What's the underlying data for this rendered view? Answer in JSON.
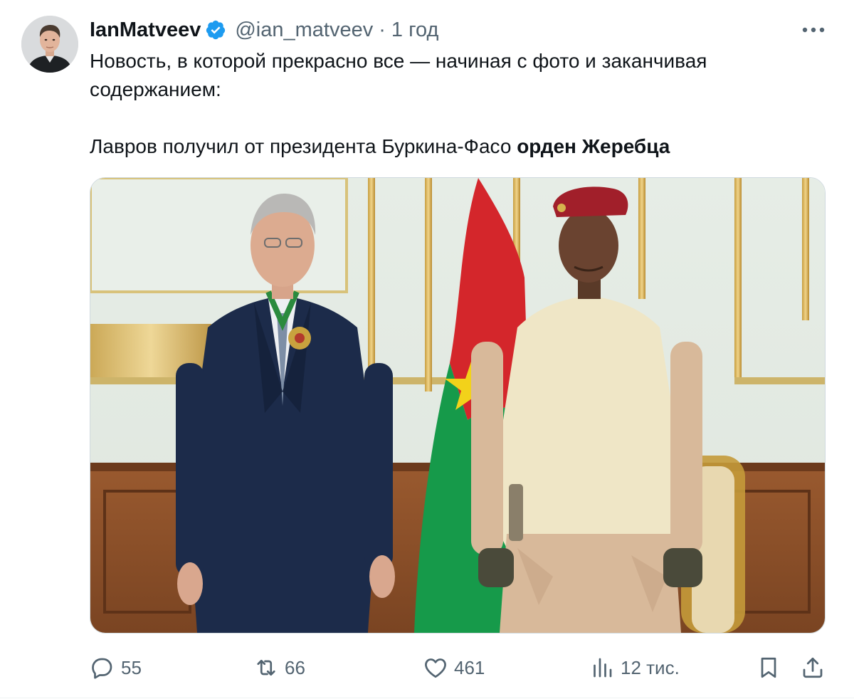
{
  "tweet": {
    "author": {
      "name": "IanMatveev",
      "handle": "@ian_matveev",
      "separator": "·",
      "time": "1 год",
      "verified": true
    },
    "text": {
      "line1": "Новость, в которой прекрасно все — начиная с фото и заканчивая",
      "line2": "содержанием:",
      "line3_plain": "Лавров получил от президента Буркина-Фасо ",
      "line3_bold": "орден Жеребца"
    },
    "metrics": {
      "replies": "55",
      "reposts": "66",
      "likes": "461",
      "views": "12 тис."
    },
    "icons": {
      "verified": "verified-badge-icon",
      "more": "more-dots-icon",
      "reply": "reply-bubble-icon",
      "repost": "repost-arrows-icon",
      "like": "heart-icon",
      "views": "analytics-bars-icon",
      "bookmark": "bookmark-icon",
      "share": "share-upload-icon"
    },
    "colors": {
      "text": "#0f1419",
      "secondary": "#536471",
      "verified": "#1d9bf0",
      "border": "#cfd9de"
    }
  }
}
